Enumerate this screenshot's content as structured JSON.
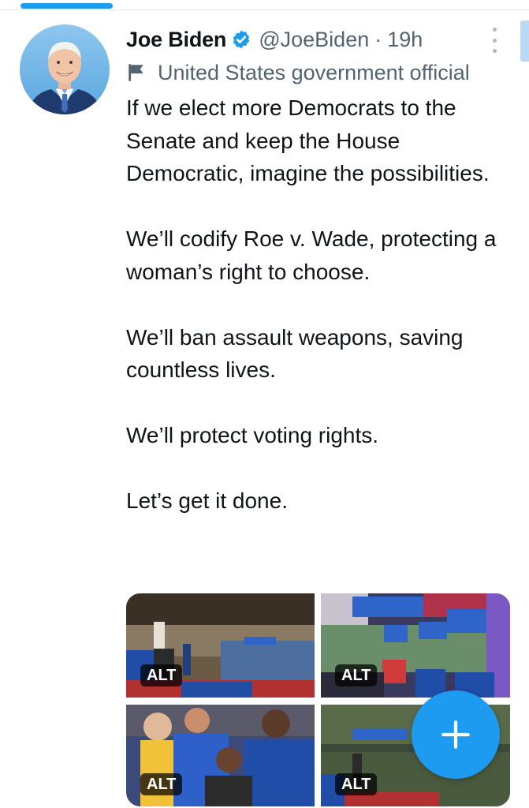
{
  "tweet": {
    "author_name": "Joe Biden",
    "handle": "@JoeBiden",
    "separator": "·",
    "time": "19h",
    "account_label": "United States government official",
    "paragraphs": [
      "If we elect more Democrats to the Senate and keep the House Democratic, imagine the possibilities.",
      "We’ll codify Roe v. Wade, protecting a woman’s right to choose.",
      "We’ll ban assault weapons, saving countless lives.",
      "We’ll protect voting rights.",
      "Let’s get it done."
    ],
    "media": [
      {
        "alt_badge": "ALT"
      },
      {
        "alt_badge": "ALT"
      },
      {
        "alt_badge": "ALT"
      },
      {
        "alt_badge": "ALT"
      }
    ]
  },
  "icons": {
    "verified": "verified-badge-icon",
    "label": "flag-icon",
    "more": "more-vertical-icon",
    "compose": "plus-icon"
  },
  "colors": {
    "accent": "#1d9bf0",
    "text": "#0f1419",
    "secondary": "#536471",
    "background": "#ffffff"
  }
}
